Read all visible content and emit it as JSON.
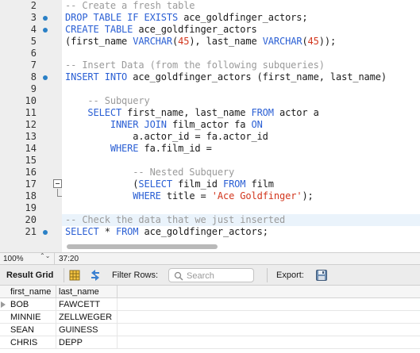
{
  "editor": {
    "current_line": 20,
    "lines": [
      {
        "n": 2,
        "marker": false,
        "tokens": [
          {
            "t": "-- Create a fresh table",
            "c": "cm"
          }
        ]
      },
      {
        "n": 3,
        "marker": true,
        "tokens": [
          {
            "t": "DROP TABLE IF EXISTS",
            "c": "kw"
          },
          {
            "t": " ace_goldfinger_actors;",
            "c": "plain"
          }
        ]
      },
      {
        "n": 4,
        "marker": true,
        "tokens": [
          {
            "t": "CREATE TABLE",
            "c": "kw"
          },
          {
            "t": " ace_goldfinger_actors",
            "c": "plain"
          }
        ]
      },
      {
        "n": 5,
        "marker": false,
        "tokens": [
          {
            "t": "(first_name ",
            "c": "plain"
          },
          {
            "t": "VARCHAR",
            "c": "kw"
          },
          {
            "t": "(",
            "c": "plain"
          },
          {
            "t": "45",
            "c": "num"
          },
          {
            "t": "), last_name ",
            "c": "plain"
          },
          {
            "t": "VARCHAR",
            "c": "kw"
          },
          {
            "t": "(",
            "c": "plain"
          },
          {
            "t": "45",
            "c": "num"
          },
          {
            "t": "));",
            "c": "plain"
          }
        ]
      },
      {
        "n": 6,
        "marker": false,
        "tokens": []
      },
      {
        "n": 7,
        "marker": false,
        "tokens": [
          {
            "t": "-- Insert Data (from the following subqueries)",
            "c": "cm"
          }
        ]
      },
      {
        "n": 8,
        "marker": true,
        "tokens": [
          {
            "t": "INSERT INTO",
            "c": "kw"
          },
          {
            "t": " ace_goldfinger_actors (first_name, last_name)",
            "c": "plain"
          }
        ]
      },
      {
        "n": 9,
        "marker": false,
        "tokens": []
      },
      {
        "n": 10,
        "marker": false,
        "tokens": [
          {
            "t": "    -- Subquery",
            "c": "cm"
          }
        ]
      },
      {
        "n": 11,
        "marker": false,
        "tokens": [
          {
            "t": "    ",
            "c": "plain"
          },
          {
            "t": "SELECT",
            "c": "kw"
          },
          {
            "t": " first_name, last_name ",
            "c": "plain"
          },
          {
            "t": "FROM",
            "c": "kw"
          },
          {
            "t": " actor a",
            "c": "plain"
          }
        ]
      },
      {
        "n": 12,
        "marker": false,
        "tokens": [
          {
            "t": "        ",
            "c": "plain"
          },
          {
            "t": "INNER JOIN",
            "c": "kw"
          },
          {
            "t": " film_actor fa ",
            "c": "plain"
          },
          {
            "t": "ON",
            "c": "kw"
          }
        ]
      },
      {
        "n": 13,
        "marker": false,
        "tokens": [
          {
            "t": "            a.actor_id = fa.actor_id",
            "c": "plain"
          }
        ]
      },
      {
        "n": 14,
        "marker": false,
        "tokens": [
          {
            "t": "        ",
            "c": "plain"
          },
          {
            "t": "WHERE",
            "c": "kw"
          },
          {
            "t": " fa.film_id =",
            "c": "plain"
          }
        ]
      },
      {
        "n": 15,
        "marker": false,
        "tokens": []
      },
      {
        "n": 16,
        "marker": false,
        "tokens": [
          {
            "t": "            -- Nested Subquery",
            "c": "cm"
          }
        ]
      },
      {
        "n": 17,
        "marker": false,
        "fold": true,
        "tokens": [
          {
            "t": "            (",
            "c": "plain"
          },
          {
            "t": "SELECT",
            "c": "kw"
          },
          {
            "t": " film_id ",
            "c": "plain"
          },
          {
            "t": "FROM",
            "c": "kw"
          },
          {
            "t": " film",
            "c": "plain"
          }
        ]
      },
      {
        "n": 18,
        "marker": false,
        "fold_end": true,
        "tokens": [
          {
            "t": "            ",
            "c": "plain"
          },
          {
            "t": "WHERE",
            "c": "kw"
          },
          {
            "t": " title = ",
            "c": "plain"
          },
          {
            "t": "'Ace Goldfinger'",
            "c": "str"
          },
          {
            "t": ");",
            "c": "plain"
          }
        ]
      },
      {
        "n": 19,
        "marker": false,
        "tokens": []
      },
      {
        "n": 20,
        "marker": false,
        "tokens": [
          {
            "t": "-- Check the data that we just inserted",
            "c": "cm"
          }
        ]
      },
      {
        "n": 21,
        "marker": true,
        "tokens": [
          {
            "t": "SELECT",
            "c": "kw"
          },
          {
            "t": " * ",
            "c": "plain"
          },
          {
            "t": "FROM",
            "c": "kw"
          },
          {
            "t": " ace_goldfinger_actors;",
            "c": "plain"
          }
        ]
      }
    ]
  },
  "status": {
    "zoom": "100%",
    "zoom_stepper": "⌃⌄",
    "cursor_position": "37:20"
  },
  "result_toolbar": {
    "result_grid_label": "Result Grid",
    "filter_rows_label": "Filter Rows:",
    "search_placeholder": "Search",
    "search_value": "",
    "export_label": "Export:"
  },
  "grid": {
    "columns": [
      "first_name",
      "last_name"
    ],
    "rows": [
      [
        "BOB",
        "FAWCETT"
      ],
      [
        "MINNIE",
        "ZELLWEGER"
      ],
      [
        "SEAN",
        "GUINESS"
      ],
      [
        "CHRIS",
        "DEPP"
      ]
    ]
  },
  "colors": {
    "keyword": "#2a5fd4",
    "comment": "#9a9a9a",
    "string": "#d2361d",
    "marker": "#2a80c6",
    "current_line": "#eaf3fb"
  },
  "icons": [
    "grid-view-icon",
    "wrap-cell-icon",
    "search-icon",
    "export-icon",
    "fold-toggle-icon",
    "row-pointer-icon"
  ]
}
